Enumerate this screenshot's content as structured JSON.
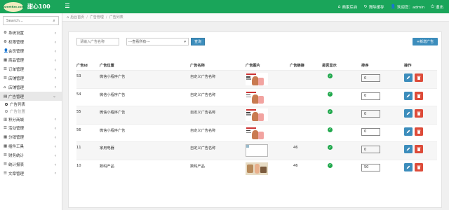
{
  "topbar": {
    "logo_text": "SweetRec.com",
    "brand": "甜心100",
    "items": [
      {
        "icon": "home-icon",
        "label": "商家后台"
      },
      {
        "icon": "refresh-icon",
        "label": "清除缓存"
      },
      {
        "icon": "user-icon",
        "label": "欢迎您：admin"
      },
      {
        "icon": "logout-icon",
        "label": "退出"
      }
    ]
  },
  "sidebar": {
    "search_placeholder": "Search...",
    "items": [
      {
        "icon": "gear-icon",
        "label": "系统设置"
      },
      {
        "icon": "gear-icon",
        "label": "权限管理"
      },
      {
        "icon": "user-icon",
        "label": "会员管理"
      },
      {
        "icon": "grid-icon",
        "label": "商品管理"
      },
      {
        "icon": "list-icon",
        "label": "订单管理"
      },
      {
        "icon": "list-icon",
        "label": "店铺管理"
      },
      {
        "icon": "home-icon",
        "label": "店铺管理"
      },
      {
        "icon": "folder-icon",
        "label": "广告管理"
      }
    ],
    "sub_items": [
      {
        "label": "广告列表"
      },
      {
        "label": "广告位置"
      }
    ],
    "items_after": [
      {
        "icon": "building-icon",
        "label": "积分商城"
      },
      {
        "icon": "list-icon",
        "label": "活动管理"
      },
      {
        "icon": "grid-icon",
        "label": "分销管理"
      },
      {
        "icon": "grid-icon",
        "label": "插件工具"
      },
      {
        "icon": "list-icon",
        "label": "财务统计"
      },
      {
        "icon": "list-icon",
        "label": "统计报表"
      },
      {
        "icon": "list-icon",
        "label": "文章管理"
      }
    ]
  },
  "breadcrumb": [
    "后台首页",
    "广告管理",
    "广告列表"
  ],
  "filter": {
    "name_placeholder": "请输入广告名称",
    "select_value": "---查看所有---",
    "query_label": "查询",
    "add_label": "+新增广告"
  },
  "table": {
    "headers": [
      "广告id",
      "广告位置",
      "广告名称",
      "广告图片",
      "广告链接",
      "是否显示",
      "排序",
      "操作"
    ],
    "rows": [
      {
        "id": "53",
        "position": "微信小程序广告",
        "name": "自定义广告名称",
        "image": "promo",
        "link": "",
        "shown": true,
        "sort": "0"
      },
      {
        "id": "54",
        "position": "微信小程序广告",
        "name": "自定义广告名称",
        "image": "promo",
        "link": "",
        "shown": true,
        "sort": "0"
      },
      {
        "id": "55",
        "position": "微信小程序广告",
        "name": "自定义广告名称",
        "image": "promo",
        "link": "",
        "shown": true,
        "sort": "0"
      },
      {
        "id": "56",
        "position": "微信小程序广告",
        "name": "自定义广告名称",
        "image": "promo",
        "link": "",
        "shown": true,
        "sort": "0"
      },
      {
        "id": "11",
        "position": "家用电器",
        "name": "自定义广告名称",
        "image": "blank",
        "link": "46",
        "shown": true,
        "sort": "0"
      },
      {
        "id": "10",
        "position": "数码产品",
        "name": "数码产品",
        "image": "photo",
        "link": "46",
        "shown": true,
        "sort": "50"
      }
    ]
  },
  "colors": {
    "topbar": "#1aa55a",
    "primary": "#3c8dbc",
    "danger": "#dd4b39",
    "success": "#20a84c"
  }
}
